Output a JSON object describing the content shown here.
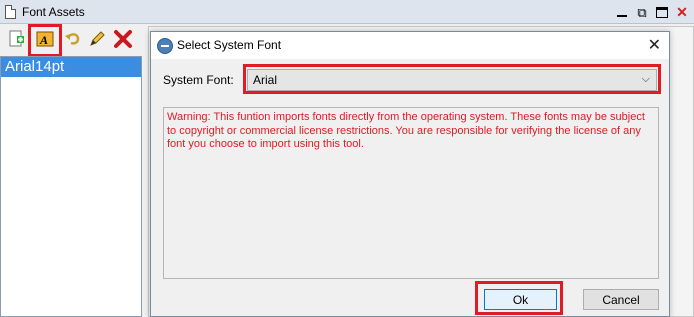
{
  "panel": {
    "title": "Font Assets",
    "icons": [
      "document-icon",
      "minimize-icon",
      "undock-icon",
      "maximize-icon",
      "close-icon"
    ],
    "toolbar": [
      "new-asset-icon",
      "add-system-font-icon",
      "undo-icon",
      "edit-icon",
      "delete-icon"
    ],
    "assets": [
      "Arial14pt"
    ]
  },
  "dialog": {
    "title": "Select System Font",
    "font_label": "System Font:",
    "font_value": "Arial",
    "warning": "Warning: This funtion imports fonts directly from the operating system.  These fonts may be subject to copyright or commercial license restrictions.  You are responsible for verifying the license of any font you choose to import using this tool.",
    "ok_label": "Ok",
    "cancel_label": "Cancel"
  },
  "colors": {
    "highlight": "#e01b24",
    "selection": "#3a8de0",
    "warning_text": "#e01b24"
  }
}
